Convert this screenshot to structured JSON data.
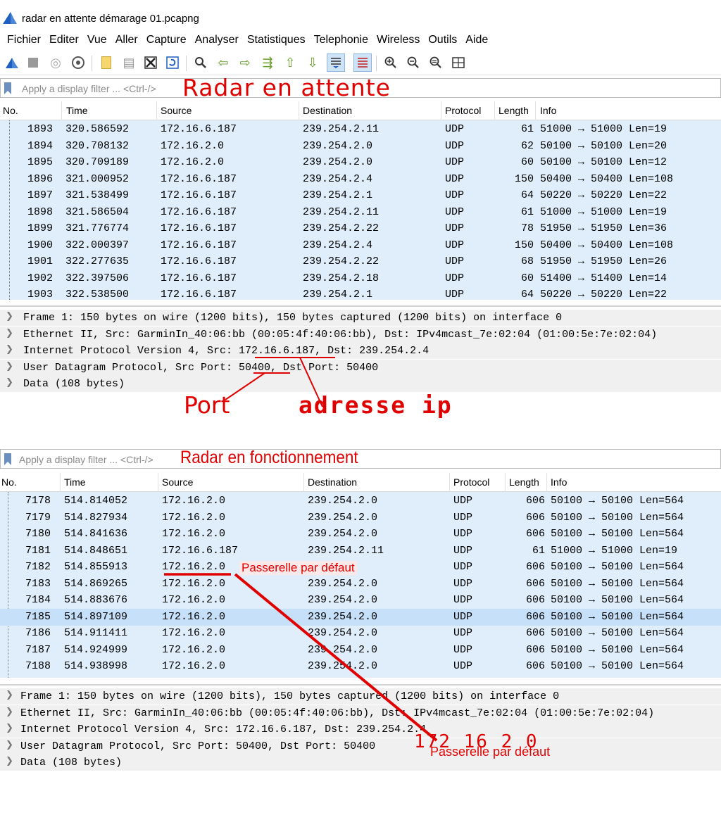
{
  "window": {
    "title": "radar en attente démarage 01.pcapng"
  },
  "menu": [
    "Fichier",
    "Editer",
    "Vue",
    "Aller",
    "Capture",
    "Analyser",
    "Statistiques",
    "Telephonie",
    "Wireless",
    "Outils",
    "Aide"
  ],
  "toolbar": {
    "icons": [
      "shark-start-icon",
      "stop-icon",
      "restart-icon",
      "options-gear-icon",
      "open-file-icon",
      "save-file-icon",
      "close-file-icon",
      "reload-icon",
      "find-icon",
      "back-arrow-icon",
      "forward-arrow-icon",
      "go-to-packet-icon",
      "first-packet-icon",
      "last-packet-icon",
      "autoscroll-icon",
      "colorize-icon",
      "zoom-in-icon",
      "zoom-out-icon",
      "normal-size-icon",
      "resize-columns-icon"
    ]
  },
  "columns": {
    "no": "No.",
    "time": "Time",
    "source": "Source",
    "destination": "Destination",
    "protocol": "Protocol",
    "length": "Length",
    "info": "Info"
  },
  "panel1": {
    "filter_placeholder": "Apply a display filter ... <Ctrl-/>",
    "annotation": "Radar en attente",
    "rows": [
      {
        "no": "1893",
        "time": "320.586592",
        "source": "172.16.6.187",
        "destination": "239.254.2.11",
        "protocol": "UDP",
        "length": "61",
        "info": "51000 → 51000 Len=19"
      },
      {
        "no": "1894",
        "time": "320.708132",
        "source": "172.16.2.0",
        "destination": "239.254.2.0",
        "protocol": "UDP",
        "length": "62",
        "info": "50100 → 50100 Len=20"
      },
      {
        "no": "1895",
        "time": "320.709189",
        "source": "172.16.2.0",
        "destination": "239.254.2.0",
        "protocol": "UDP",
        "length": "60",
        "info": "50100 → 50100 Len=12"
      },
      {
        "no": "1896",
        "time": "321.000952",
        "source": "172.16.6.187",
        "destination": "239.254.2.4",
        "protocol": "UDP",
        "length": "150",
        "info": "50400 → 50400 Len=108"
      },
      {
        "no": "1897",
        "time": "321.538499",
        "source": "172.16.6.187",
        "destination": "239.254.2.1",
        "protocol": "UDP",
        "length": "64",
        "info": "50220 → 50220 Len=22"
      },
      {
        "no": "1898",
        "time": "321.586504",
        "source": "172.16.6.187",
        "destination": "239.254.2.11",
        "protocol": "UDP",
        "length": "61",
        "info": "51000 → 51000 Len=19"
      },
      {
        "no": "1899",
        "time": "321.776774",
        "source": "172.16.6.187",
        "destination": "239.254.2.22",
        "protocol": "UDP",
        "length": "78",
        "info": "51950 → 51950 Len=36"
      },
      {
        "no": "1900",
        "time": "322.000397",
        "source": "172.16.6.187",
        "destination": "239.254.2.4",
        "protocol": "UDP",
        "length": "150",
        "info": "50400 → 50400 Len=108"
      },
      {
        "no": "1901",
        "time": "322.277635",
        "source": "172.16.6.187",
        "destination": "239.254.2.22",
        "protocol": "UDP",
        "length": "68",
        "info": "51950 → 51950 Len=26"
      },
      {
        "no": "1902",
        "time": "322.397506",
        "source": "172.16.6.187",
        "destination": "239.254.2.18",
        "protocol": "UDP",
        "length": "60",
        "info": "51400 → 51400 Len=14"
      },
      {
        "no": "1903",
        "time": "322.538500",
        "source": "172.16.6.187",
        "destination": "239.254.2.1",
        "protocol": "UDP",
        "length": "64",
        "info": "50220 → 50220 Len=22"
      }
    ],
    "details": [
      "Frame 1: 150 bytes on wire (1200 bits), 150 bytes captured (1200 bits) on interface 0",
      "Ethernet II, Src: GarminIn_40:06:bb (00:05:4f:40:06:bb), Dst: IPv4mcast_7e:02:04 (01:00:5e:7e:02:04)",
      "Internet Protocol Version 4, Src: 172.16.6.187, Dst: 239.254.2.4",
      "User Datagram Protocol, Src Port: 50400, Dst Port: 50400",
      "Data (108 bytes)"
    ],
    "annot_port": "Port",
    "annot_ip": "adresse ip"
  },
  "panel2": {
    "filter_placeholder": "Apply a display filter ... <Ctrl-/>",
    "annotation": "Radar en fonctionnement",
    "rows": [
      {
        "no": "7178",
        "time": "514.814052",
        "source": "172.16.2.0",
        "destination": "239.254.2.0",
        "protocol": "UDP",
        "length": "606",
        "info": "50100 → 50100 Len=564"
      },
      {
        "no": "7179",
        "time": "514.827934",
        "source": "172.16.2.0",
        "destination": "239.254.2.0",
        "protocol": "UDP",
        "length": "606",
        "info": "50100 → 50100 Len=564"
      },
      {
        "no": "7180",
        "time": "514.841636",
        "source": "172.16.2.0",
        "destination": "239.254.2.0",
        "protocol": "UDP",
        "length": "606",
        "info": "50100 → 50100 Len=564"
      },
      {
        "no": "7181",
        "time": "514.848651",
        "source": "172.16.6.187",
        "destination": "239.254.2.11",
        "protocol": "UDP",
        "length": "61",
        "info": "51000 → 51000 Len=19"
      },
      {
        "no": "7182",
        "time": "514.855913",
        "source": "172.16.2.0",
        "destination": "",
        "protocol": "UDP",
        "length": "606",
        "info": "50100 → 50100 Len=564"
      },
      {
        "no": "7183",
        "time": "514.869265",
        "source": "172.16.2.0",
        "destination": "239.254.2.0",
        "protocol": "UDP",
        "length": "606",
        "info": "50100 → 50100 Len=564"
      },
      {
        "no": "7184",
        "time": "514.883676",
        "source": "172.16.2.0",
        "destination": "239.254.2.0",
        "protocol": "UDP",
        "length": "606",
        "info": "50100 → 50100 Len=564"
      },
      {
        "no": "7185",
        "time": "514.897109",
        "source": "172.16.2.0",
        "destination": "239.254.2.0",
        "protocol": "UDP",
        "length": "606",
        "info": "50100 → 50100 Len=564"
      },
      {
        "no": "7186",
        "time": "514.911411",
        "source": "172.16.2.0",
        "destination": "239.254.2.0",
        "protocol": "UDP",
        "length": "606",
        "info": "50100 → 50100 Len=564"
      },
      {
        "no": "7187",
        "time": "514.924999",
        "source": "172.16.2.0",
        "destination": "239.254.2.0",
        "protocol": "UDP",
        "length": "606",
        "info": "50100 → 50100 Len=564"
      },
      {
        "no": "7188",
        "time": "514.938998",
        "source": "172.16.2.0",
        "destination": "239.254.2.0",
        "protocol": "UDP",
        "length": "606",
        "info": "50100 → 50100 Len=564"
      }
    ],
    "details": [
      "Frame 1: 150 bytes on wire (1200 bits), 150 bytes captured (1200 bits) on interface 0",
      "Ethernet II, Src: GarminIn_40:06:bb (00:05:4f:40:06:bb), Dst: IPv4mcast_7e:02:04 (01:00:5e:7e:02:04)",
      "Internet Protocol Version 4, Src: 172.16.6.187, Dst: 239.254.2.4",
      "User Datagram Protocol, Src Port: 50400, Dst Port: 50400",
      "Data (108 bytes)"
    ],
    "annot_gateway_inline": "Passerelle par défaut",
    "annot_gateway_ip": "172 16 2 0",
    "annot_gateway_bottom": "Passerelle par défaut"
  },
  "colors": {
    "row_bg": "#dfeefa",
    "selected_row_bg": "#c6e0fa",
    "annotation_red": "#e00000"
  }
}
